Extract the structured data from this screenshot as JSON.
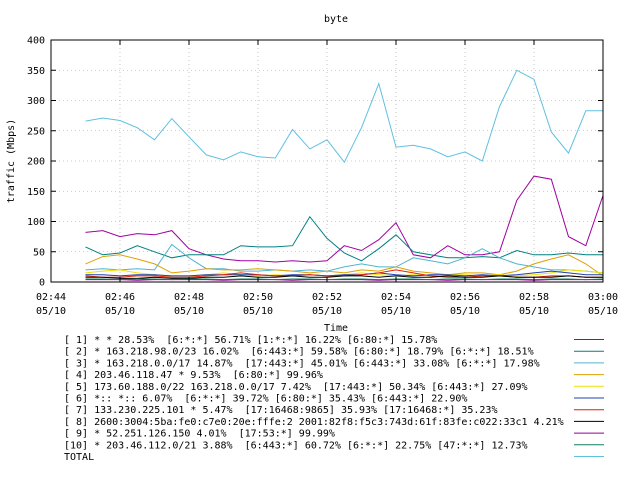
{
  "chart_data": {
    "type": "line",
    "title": "byte",
    "xlabel": "Time",
    "ylabel": "traffic (Mbps)",
    "ylim": [
      0,
      400
    ],
    "yticks": [
      0,
      50,
      100,
      150,
      200,
      250,
      300,
      350,
      400
    ],
    "xlim": [
      "02:44",
      "03:00"
    ],
    "xtick_labels": [
      {
        "time": "02:44",
        "date": "05/10"
      },
      {
        "time": "02:46",
        "date": "05/10"
      },
      {
        "time": "02:48",
        "date": "05/10"
      },
      {
        "time": "02:50",
        "date": "05/10"
      },
      {
        "time": "02:52",
        "date": "05/10"
      },
      {
        "time": "02:54",
        "date": "05/10"
      },
      {
        "time": "02:56",
        "date": "05/10"
      },
      {
        "time": "02:58",
        "date": "05/10"
      },
      {
        "time": "03:00",
        "date": "05/10"
      }
    ],
    "grid": true,
    "legend_position": "bottom",
    "x": [
      "02:45:00",
      "02:45:30",
      "02:46:00",
      "02:46:30",
      "02:47:00",
      "02:47:30",
      "02:48:00",
      "02:48:30",
      "02:49:00",
      "02:49:30",
      "02:50:00",
      "02:50:30",
      "02:51:00",
      "02:51:30",
      "02:52:00",
      "02:52:30",
      "02:53:00",
      "02:53:30",
      "02:54:00",
      "02:54:30",
      "02:55:00",
      "02:55:30",
      "02:56:00",
      "02:56:30",
      "02:57:00",
      "02:57:30",
      "02:58:00",
      "02:58:30",
      "02:59:00",
      "02:59:30"
    ],
    "series": [
      {
        "name": "[ 1] * * 28.53%  [6:*:*] 56.71% [1:*:*] 16.22% [6:80:*] 15.78%",
        "color": "#a000a0",
        "values": [
          82,
          85,
          75,
          80,
          78,
          85,
          55,
          45,
          38,
          35,
          35,
          33,
          35,
          33,
          35,
          60,
          52,
          70,
          98,
          45,
          40,
          60,
          45,
          45,
          50,
          135,
          175,
          170,
          75,
          60,
          143
        ]
      },
      {
        "name": "[ 2] * 163.218.98.0/23 16.02%  [6:443:*] 59.58% [6:80:*] 18.79% [6:*:*] 18.51%",
        "color": "#008080",
        "values": [
          58,
          45,
          48,
          60,
          50,
          40,
          45,
          45,
          45,
          60,
          58,
          58,
          60,
          108,
          72,
          48,
          35,
          55,
          78,
          50,
          45,
          40,
          40,
          42,
          40,
          52,
          45,
          45,
          48,
          45,
          45
        ]
      },
      {
        "name": "[ 3] * 163.218.0.0/17 14.87%  [17:443:*] 45.01% [6:443:*] 33.08% [6:*:*] 17.98%",
        "color": "#50b4d0",
        "values": [
          20,
          22,
          20,
          22,
          20,
          62,
          40,
          22,
          22,
          18,
          18,
          20,
          18,
          20,
          18,
          25,
          30,
          25,
          25,
          40,
          35,
          30,
          40,
          55,
          40,
          30,
          25,
          20,
          20,
          18,
          15
        ]
      },
      {
        "name": "[ 4] 203.46.118.47 * 9.53%  [6:80:*] 99.96%",
        "color": "#e0a000",
        "values": [
          30,
          42,
          45,
          38,
          30,
          15,
          18,
          22,
          20,
          20,
          22,
          20,
          18,
          15,
          18,
          15,
          20,
          18,
          25,
          18,
          15,
          12,
          15,
          15,
          12,
          18,
          30,
          38,
          45,
          30,
          10
        ]
      },
      {
        "name": "[ 5] 173.60.188.0/22 163.218.0.0/17 7.42%  [17:443:*] 50.34% [6:443:*] 27.09%",
        "color": "#f0e000",
        "values": [
          15,
          18,
          20,
          15,
          12,
          10,
          10,
          12,
          15,
          12,
          10,
          12,
          10,
          12,
          10,
          12,
          15,
          12,
          10,
          12,
          10,
          12,
          12,
          10,
          12,
          10,
          12,
          15,
          20,
          18,
          15
        ]
      },
      {
        "name": "[ 6] *:: *:: 6.07%  [6:*:*] 39.72% [6:80:*] 35.43% [6:443:*] 22.90%",
        "color": "#2040b0",
        "values": [
          12,
          12,
          10,
          12,
          12,
          10,
          10,
          12,
          12,
          12,
          12,
          10,
          12,
          12,
          10,
          12,
          12,
          15,
          12,
          10,
          12,
          12,
          10,
          12,
          10,
          12,
          15,
          18,
          15,
          12,
          12
        ]
      },
      {
        "name": "[ 7] 133.230.225.101 * 5.47%  [17:16468:9865] 35.93% [17:16468:*] 35.23%",
        "color": "#e02000",
        "values": [
          10,
          8,
          8,
          10,
          10,
          8,
          8,
          10,
          12,
          15,
          12,
          10,
          10,
          12,
          10,
          10,
          12,
          15,
          20,
          15,
          10,
          8,
          8,
          10,
          10,
          8,
          8,
          10,
          10,
          8,
          8
        ]
      },
      {
        "name": "[ 8] 2600:3004:5ba:fe0:c7e0:20e:fffe:2 2001:82f8:f5c3:743d:61f:83fe:c022:33c1 4.21%",
        "color": "#000000",
        "values": [
          8,
          8,
          6,
          6,
          8,
          6,
          6,
          8,
          8,
          10,
          8,
          8,
          10,
          8,
          8,
          10,
          10,
          8,
          10,
          8,
          8,
          10,
          8,
          8,
          10,
          8,
          8,
          8,
          10,
          8,
          8
        ]
      },
      {
        "name": "[ 9] * 52.251.126.150 4.01%  [17:53:*] 99.99%",
        "color": "#900090",
        "values": [
          4,
          4,
          4,
          3,
          4,
          4,
          4,
          4,
          3,
          4,
          4,
          4,
          3,
          4,
          4,
          4,
          4,
          3,
          4,
          4,
          4,
          3,
          4,
          4,
          4,
          4,
          3,
          4,
          4,
          4,
          4
        ]
      },
      {
        "name": "[10] * 203.46.112.0/21 3.88%  [6:443:*] 60.72% [6:*:*] 22.75% [47:*:*] 12.73%",
        "color": "#108060",
        "values": [
          5,
          5,
          4,
          5,
          5,
          4,
          5,
          5,
          4,
          5,
          5,
          4,
          5,
          5,
          4,
          5,
          5,
          4,
          5,
          5,
          4,
          5,
          5,
          4,
          5,
          5,
          4,
          5,
          5,
          4,
          5
        ]
      },
      {
        "name": "TOTAL",
        "color": "#60c0e0",
        "values": [
          266,
          271,
          267,
          255,
          235,
          270,
          240,
          210,
          202,
          215,
          207,
          205,
          252,
          220,
          235,
          198,
          255,
          328,
          223,
          226,
          220,
          207,
          215,
          200,
          290,
          350,
          335,
          248,
          213,
          283,
          283
        ]
      }
    ]
  }
}
